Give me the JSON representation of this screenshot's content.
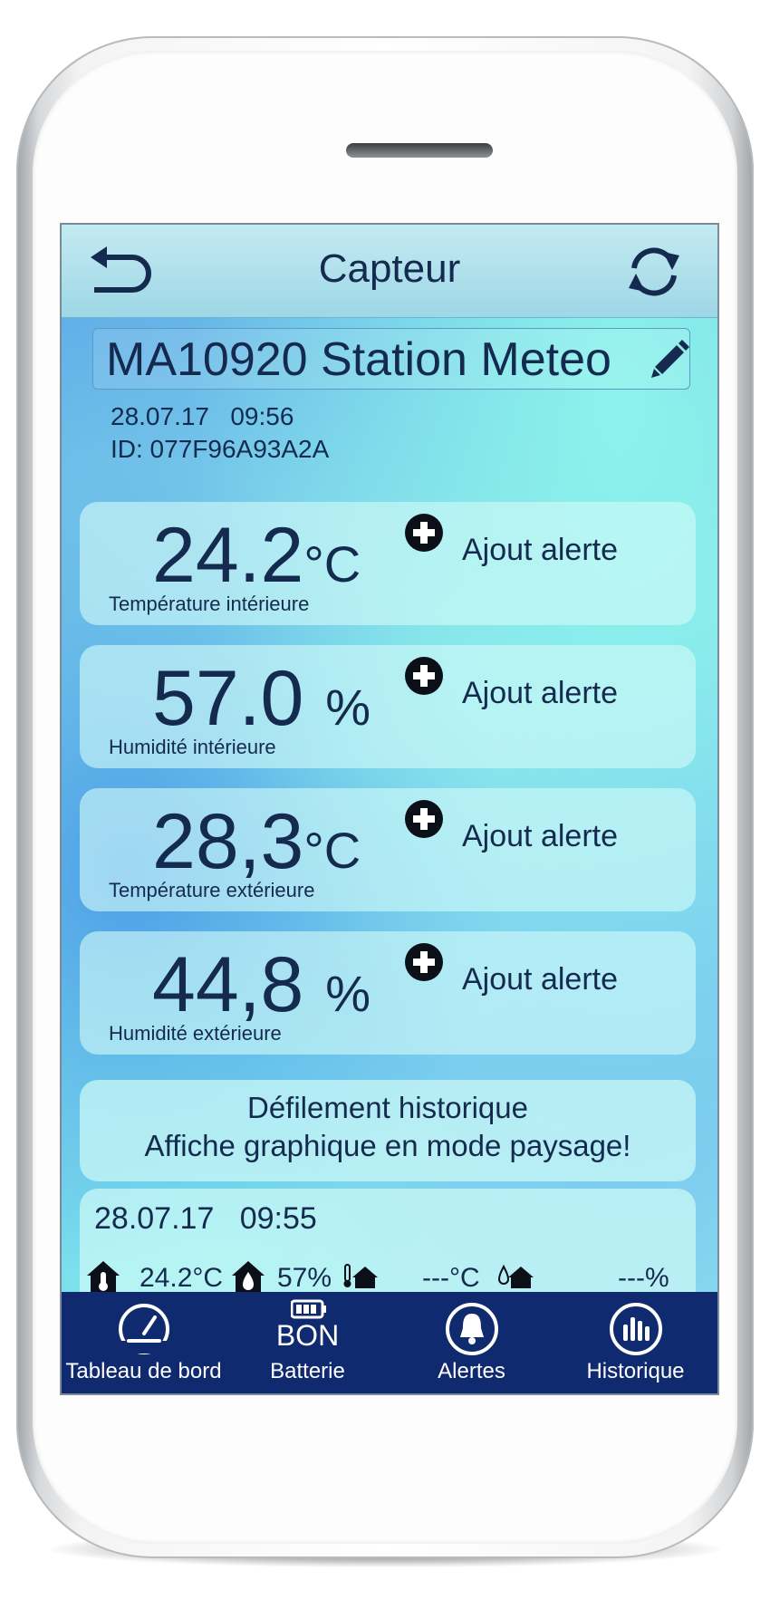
{
  "colors": {
    "text_dark": "#142a4e",
    "tabbar_bg": "#0f2a6e",
    "navbar_bg": "#aee0ec",
    "card_bg": "#d2faf8"
  },
  "header": {
    "title": "Capteur",
    "back_icon": "back-arrow-icon",
    "refresh_icon": "refresh-icon"
  },
  "device": {
    "name": "MA10920 Station Meteo",
    "date": "28.07.17",
    "time": "09:56",
    "id": "ID: 077F96A93A2A"
  },
  "readings": [
    {
      "value": "24.2",
      "unit": "°C",
      "label": "Température intérieure",
      "alert_label": "Ajout alerte"
    },
    {
      "value": "57.0",
      "unit": "%",
      "label": "Humidité intérieure",
      "alert_label": "Ajout alerte"
    },
    {
      "value": "28,3",
      "unit": "°C",
      "label": "Température extérieure",
      "alert_label": "Ajout alerte"
    },
    {
      "value": "44,8",
      "unit": "%",
      "label": "Humidité extérieure",
      "alert_label": "Ajout alerte"
    }
  ],
  "history_info": {
    "line1": "Défilement historique",
    "line2": "Affiche graphique en mode paysage!"
  },
  "last_record": {
    "date": "28.07.17",
    "time": "09:55",
    "indoor_temp": "24.2°C",
    "indoor_humidity": "57%",
    "outdoor_temp": "---°C",
    "outdoor_humidity": "---%"
  },
  "tabs": [
    {
      "label": "Tableau de bord",
      "icon": "gauge-icon"
    },
    {
      "label": "Batterie",
      "icon": "battery-icon",
      "status": "BON"
    },
    {
      "label": "Alertes",
      "icon": "bell-icon"
    },
    {
      "label": "Historique",
      "icon": "bar-chart-icon"
    }
  ]
}
